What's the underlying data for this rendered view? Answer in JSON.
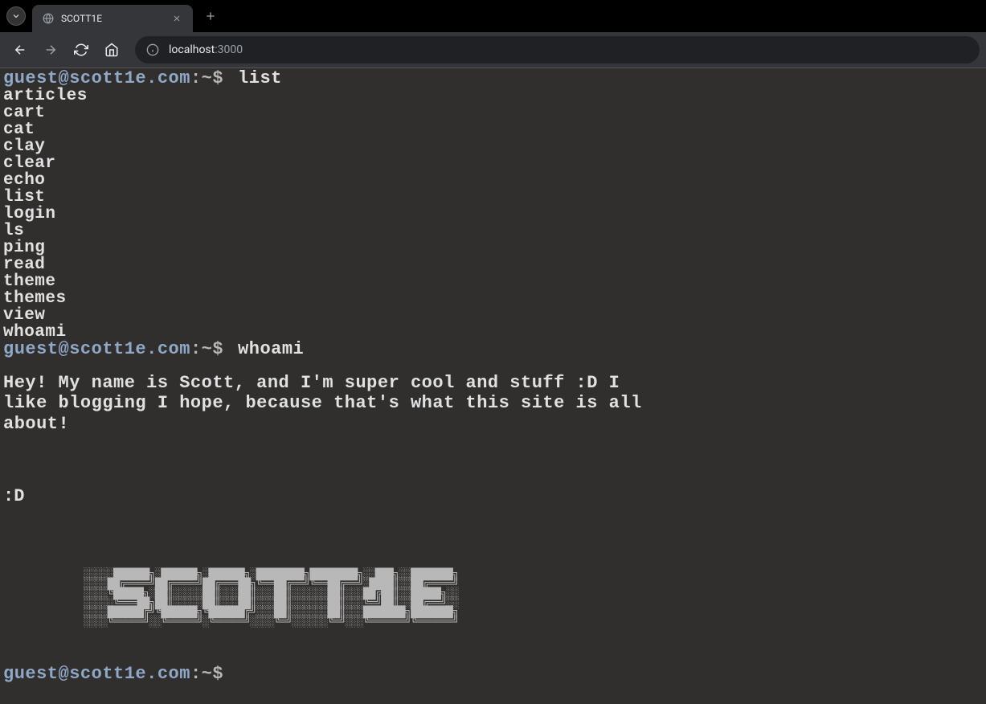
{
  "browser": {
    "tab_title": "SCOTT1E",
    "url_host": "localhost",
    "url_port": ":3000"
  },
  "terminal": {
    "prompt_user": "guest@scott1e.com",
    "prompt_suffix": ":~$",
    "cmd1": "list",
    "list_output": [
      "articles",
      "cart",
      "cat",
      "clay",
      "clear",
      "echo",
      "list",
      "login",
      "ls",
      "ping",
      "read",
      "theme",
      "themes",
      "view",
      "whoami"
    ],
    "cmd2": "whoami",
    "whoami_output": "Hey! My name is Scott, and I'm super cool and stuff :D I like blogging I hope, because that's what this site is all about!",
    "smiley": ":D",
    "ascii_art": "░░░░░██████╗░██████╗░██████╗░████████╗████████╗░░███╗░░███████╗\n░░░░██╔════╝██╔════╝██╔═══██╗╚══██╔══╝╚══██╔══╝░████║░░██╔════╝\n░░░░╚█████╗░██║░░░░░██║░░░██║░░░██║░░░░░░██║░░░██╔██║░░█████╗░░\n░░░░░╚═══██╗██║░░░░░██║░░░██║░░░██║░░░░░░██║░░░╚═╝██║░░██╔══╝░░\n░░░░██████╔╝╚██████╗╚██████╔╝░░░██║░░░░░░██║░░░███████╗███████╗\n░░░░╚═════╝░░╚═════╝░╚═════╝░░░░╚═╝░░░░░░╚═╝░░░╚══════╝╚══════╝"
  }
}
